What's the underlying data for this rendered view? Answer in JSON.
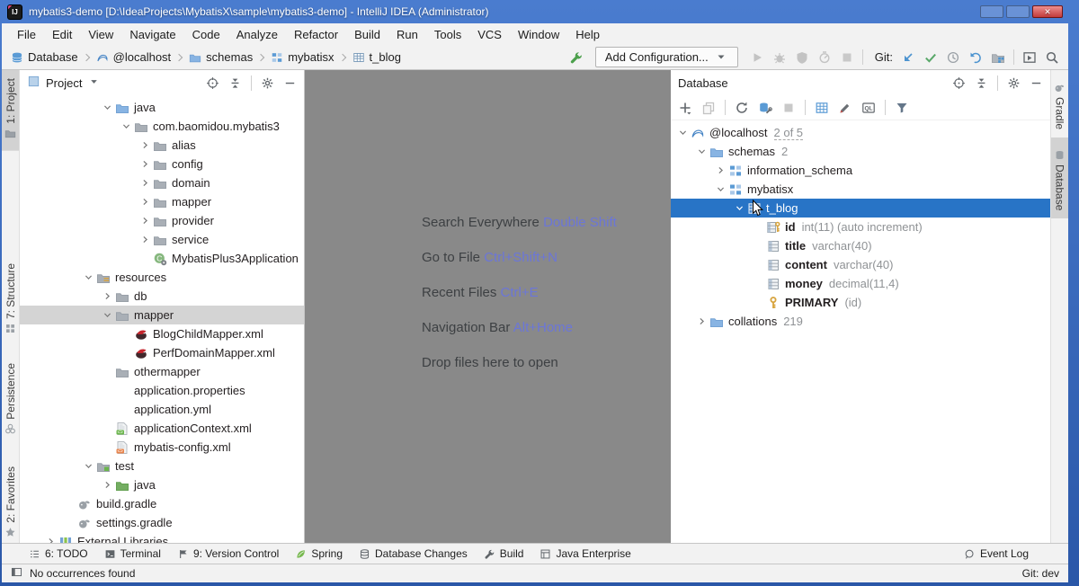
{
  "window": {
    "title": "mybatis3-demo [D:\\IdeaProjects\\MybatisX\\sample\\mybatis3-demo] - IntelliJ IDEA (Administrator)",
    "logo_text": "IJ"
  },
  "menu": [
    "File",
    "Edit",
    "View",
    "Navigate",
    "Code",
    "Analyze",
    "Refactor",
    "Build",
    "Run",
    "Tools",
    "VCS",
    "Window",
    "Help"
  ],
  "breadcrumb": [
    {
      "icon": "db-stack",
      "label": "Database"
    },
    {
      "icon": "mysql",
      "label": "@localhost"
    },
    {
      "icon": "folder-blue",
      "label": "schemas"
    },
    {
      "icon": "schema",
      "label": "mybatisx"
    },
    {
      "icon": "table",
      "label": "t_blog"
    }
  ],
  "toolbar": {
    "build_icon": "wrench-green",
    "add_configuration": "Add Configuration...",
    "run_icons": [
      "run-gray",
      "debug-gray",
      "coverage-gray",
      "profiler-gray",
      "stop-gray"
    ],
    "git_label": "Git:",
    "git_icons": [
      "git-update",
      "git-commit",
      "history",
      "rollback"
    ],
    "tail_icons": [
      "proj-structure",
      "|",
      "console-run",
      "search"
    ]
  },
  "left_strip": [
    {
      "icon": "proj-tab",
      "label": "1: Project",
      "active": true
    },
    {
      "icon": "structure-tab",
      "label": "7: Structure",
      "active": false
    },
    {
      "icon": "persistence-tab",
      "label": "Persistence",
      "active": false
    },
    {
      "icon": "favorites-tab",
      "label": "2: Favorites",
      "active": false
    }
  ],
  "right_strip": [
    {
      "icon": "gradle",
      "label": "Gradle",
      "active": false
    },
    {
      "icon": "db-tab",
      "label": "Database",
      "active": true
    }
  ],
  "project_panel": {
    "title": "Project",
    "header_icons": [
      "target",
      "collapse-all",
      "|",
      "gear",
      "minus"
    ],
    "tree": [
      {
        "depth": 3,
        "expand": "open",
        "icon": "folder-blue",
        "label": "java"
      },
      {
        "depth": 4,
        "expand": "open",
        "icon": "folder-pkg",
        "label": "com.baomidou.mybatis3"
      },
      {
        "depth": 5,
        "expand": "closed",
        "icon": "folder-pkg",
        "label": "alias"
      },
      {
        "depth": 5,
        "expand": "closed",
        "icon": "folder-pkg",
        "label": "config"
      },
      {
        "depth": 5,
        "expand": "closed",
        "icon": "folder-pkg",
        "label": "domain"
      },
      {
        "depth": 5,
        "expand": "closed",
        "icon": "folder-pkg",
        "label": "mapper"
      },
      {
        "depth": 5,
        "expand": "closed",
        "icon": "folder-pkg",
        "label": "provider"
      },
      {
        "depth": 5,
        "expand": "closed",
        "icon": "folder-pkg",
        "label": "service"
      },
      {
        "depth": 5,
        "expand": null,
        "icon": "class-spring",
        "label": "MybatisPlus3Application"
      },
      {
        "depth": 2,
        "expand": "open",
        "icon": "folder-resources",
        "label": "resources"
      },
      {
        "depth": 3,
        "expand": "closed",
        "icon": "folder-pkg",
        "label": "db"
      },
      {
        "depth": 3,
        "expand": "open",
        "icon": "folder-pkg",
        "label": "mapper",
        "selected": "gray"
      },
      {
        "depth": 4,
        "expand": null,
        "icon": "mybatis-bird",
        "label": "BlogChildMapper.xml"
      },
      {
        "depth": 4,
        "expand": null,
        "icon": "mybatis-bird",
        "label": "PerfDomainMapper.xml"
      },
      {
        "depth": 3,
        "expand": null,
        "icon": "folder-pkg",
        "label": "othermapper"
      },
      {
        "depth": 3,
        "expand": null,
        "icon": "spring-file",
        "label": "application.properties"
      },
      {
        "depth": 3,
        "expand": null,
        "icon": "spring-file",
        "label": "application.yml"
      },
      {
        "depth": 3,
        "expand": null,
        "icon": "xml-green",
        "label": "applicationContext.xml"
      },
      {
        "depth": 3,
        "expand": null,
        "icon": "xml-orange",
        "label": "mybatis-config.xml"
      },
      {
        "depth": 2,
        "expand": "open",
        "icon": "folder-test",
        "label": "test"
      },
      {
        "depth": 3,
        "expand": "closed",
        "icon": "folder-green",
        "label": "java"
      },
      {
        "depth": 1,
        "expand": null,
        "icon": "gradle",
        "label": "build.gradle"
      },
      {
        "depth": 1,
        "expand": null,
        "icon": "gradle",
        "label": "settings.gradle"
      },
      {
        "depth": 0,
        "expand": "closed",
        "icon": "lib",
        "label": "External Libraries"
      }
    ]
  },
  "editor_shortcuts": [
    {
      "label": "Search Everywhere",
      "keys": "Double Shift"
    },
    {
      "label": "Go to File",
      "keys": "Ctrl+Shift+N"
    },
    {
      "label": "Recent Files",
      "keys": "Ctrl+E"
    },
    {
      "label": "Navigation Bar",
      "keys": "Alt+Home"
    },
    {
      "label": "Drop files here to open",
      "keys": ""
    }
  ],
  "database_panel": {
    "title": "Database",
    "header_icons": [
      "target",
      "collapse-all",
      "|",
      "gear",
      "minus"
    ],
    "toolbar_icons": [
      "plus-drop",
      "copy-gray",
      "|",
      "refresh",
      "db-wrench",
      "stop-gray",
      "|",
      "grid-blue",
      "pencil",
      "ql-box",
      "|",
      "funnel"
    ],
    "tree": [
      {
        "depth": 0,
        "expand": "open",
        "icon": "mysql",
        "label": "@localhost",
        "meta": "2 of 5",
        "badge": true
      },
      {
        "depth": 1,
        "expand": "open",
        "icon": "folder-blue",
        "label": "schemas",
        "meta": "2"
      },
      {
        "depth": 2,
        "expand": "closed",
        "icon": "schema",
        "label": "information_schema"
      },
      {
        "depth": 2,
        "expand": "open",
        "icon": "schema",
        "label": "mybatisx"
      },
      {
        "depth": 3,
        "expand": "open",
        "icon": "table-sel",
        "label": "t_blog",
        "selected": "blue"
      },
      {
        "depth": 4,
        "expand": null,
        "icon": "column-key",
        "label": "id",
        "meta": "int(11) (auto increment)",
        "bold": true
      },
      {
        "depth": 4,
        "expand": null,
        "icon": "column",
        "label": "title",
        "meta": "varchar(40)",
        "bold": true
      },
      {
        "depth": 4,
        "expand": null,
        "icon": "column",
        "label": "content",
        "meta": "varchar(40)",
        "bold": true
      },
      {
        "depth": 4,
        "expand": null,
        "icon": "column",
        "label": "money",
        "meta": "decimal(11,4)",
        "bold": true
      },
      {
        "depth": 4,
        "expand": null,
        "icon": "key",
        "label": "PRIMARY",
        "meta": "(id)",
        "bold": true
      },
      {
        "depth": 1,
        "expand": "closed",
        "icon": "folder-blue",
        "label": "collations",
        "meta": "219"
      }
    ]
  },
  "bottom_bar": {
    "items": [
      {
        "icon": "todo",
        "label": "6: TODO"
      },
      {
        "icon": "terminal",
        "label": "Terminal"
      },
      {
        "icon": "vcs",
        "label": "9: Version Control"
      },
      {
        "icon": "spring-leaf",
        "label": "Spring"
      },
      {
        "icon": "db-changes",
        "label": "Database Changes"
      },
      {
        "icon": "wrench-dark",
        "label": "Build"
      },
      {
        "icon": "javaee",
        "label": "Java Enterprise"
      }
    ],
    "right": {
      "icon": "event-log",
      "label": "Event Log"
    }
  },
  "status_bar": {
    "icon": "win-toggle",
    "message": "No occurrences found",
    "git": "Git: dev"
  },
  "colors": {
    "selection_blue": "#2874c6",
    "selection_gray": "#d4d4d4",
    "accent_green": "#59a869",
    "accent_blue": "#4d94d0",
    "shortcut_purple": "#6b76d8",
    "editor_bg": "#898989",
    "titlebar_blue": "#2a57a8"
  }
}
